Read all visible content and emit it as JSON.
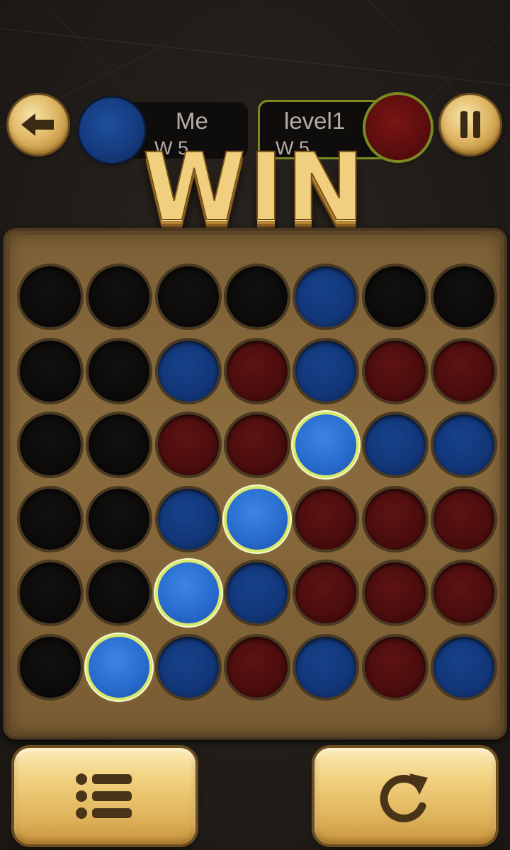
{
  "result": {
    "title": "WIN"
  },
  "players": {
    "me": {
      "name": "Me",
      "wins": "W 5",
      "color": "#143a7c"
    },
    "opponent": {
      "name": "level1",
      "wins": "W 5",
      "color": "#5c0d0d",
      "highlight": "#7b8a22"
    }
  },
  "icons": {
    "back": "arrow-left-icon",
    "pause": "pause-icon",
    "menu": "list-icon",
    "restart": "restart-icon"
  },
  "board": {
    "columns": 7,
    "rows": 6,
    "cells": [
      [
        "empty",
        "empty",
        "empty",
        "empty",
        "blue",
        "empty",
        "empty"
      ],
      [
        "empty",
        "empty",
        "blue",
        "red",
        "blue",
        "red",
        "red"
      ],
      [
        "empty",
        "empty",
        "red",
        "red",
        "blue",
        "blue",
        "blue"
      ],
      [
        "empty",
        "empty",
        "blue",
        "blue",
        "red",
        "red",
        "red"
      ],
      [
        "empty",
        "empty",
        "blue",
        "blue",
        "red",
        "red",
        "red"
      ],
      [
        "empty",
        "blue",
        "blue",
        "red",
        "blue",
        "red",
        "blue"
      ]
    ],
    "winning_line": [
      [
        2,
        4
      ],
      [
        3,
        3
      ],
      [
        4,
        2
      ],
      [
        5,
        1
      ]
    ]
  }
}
